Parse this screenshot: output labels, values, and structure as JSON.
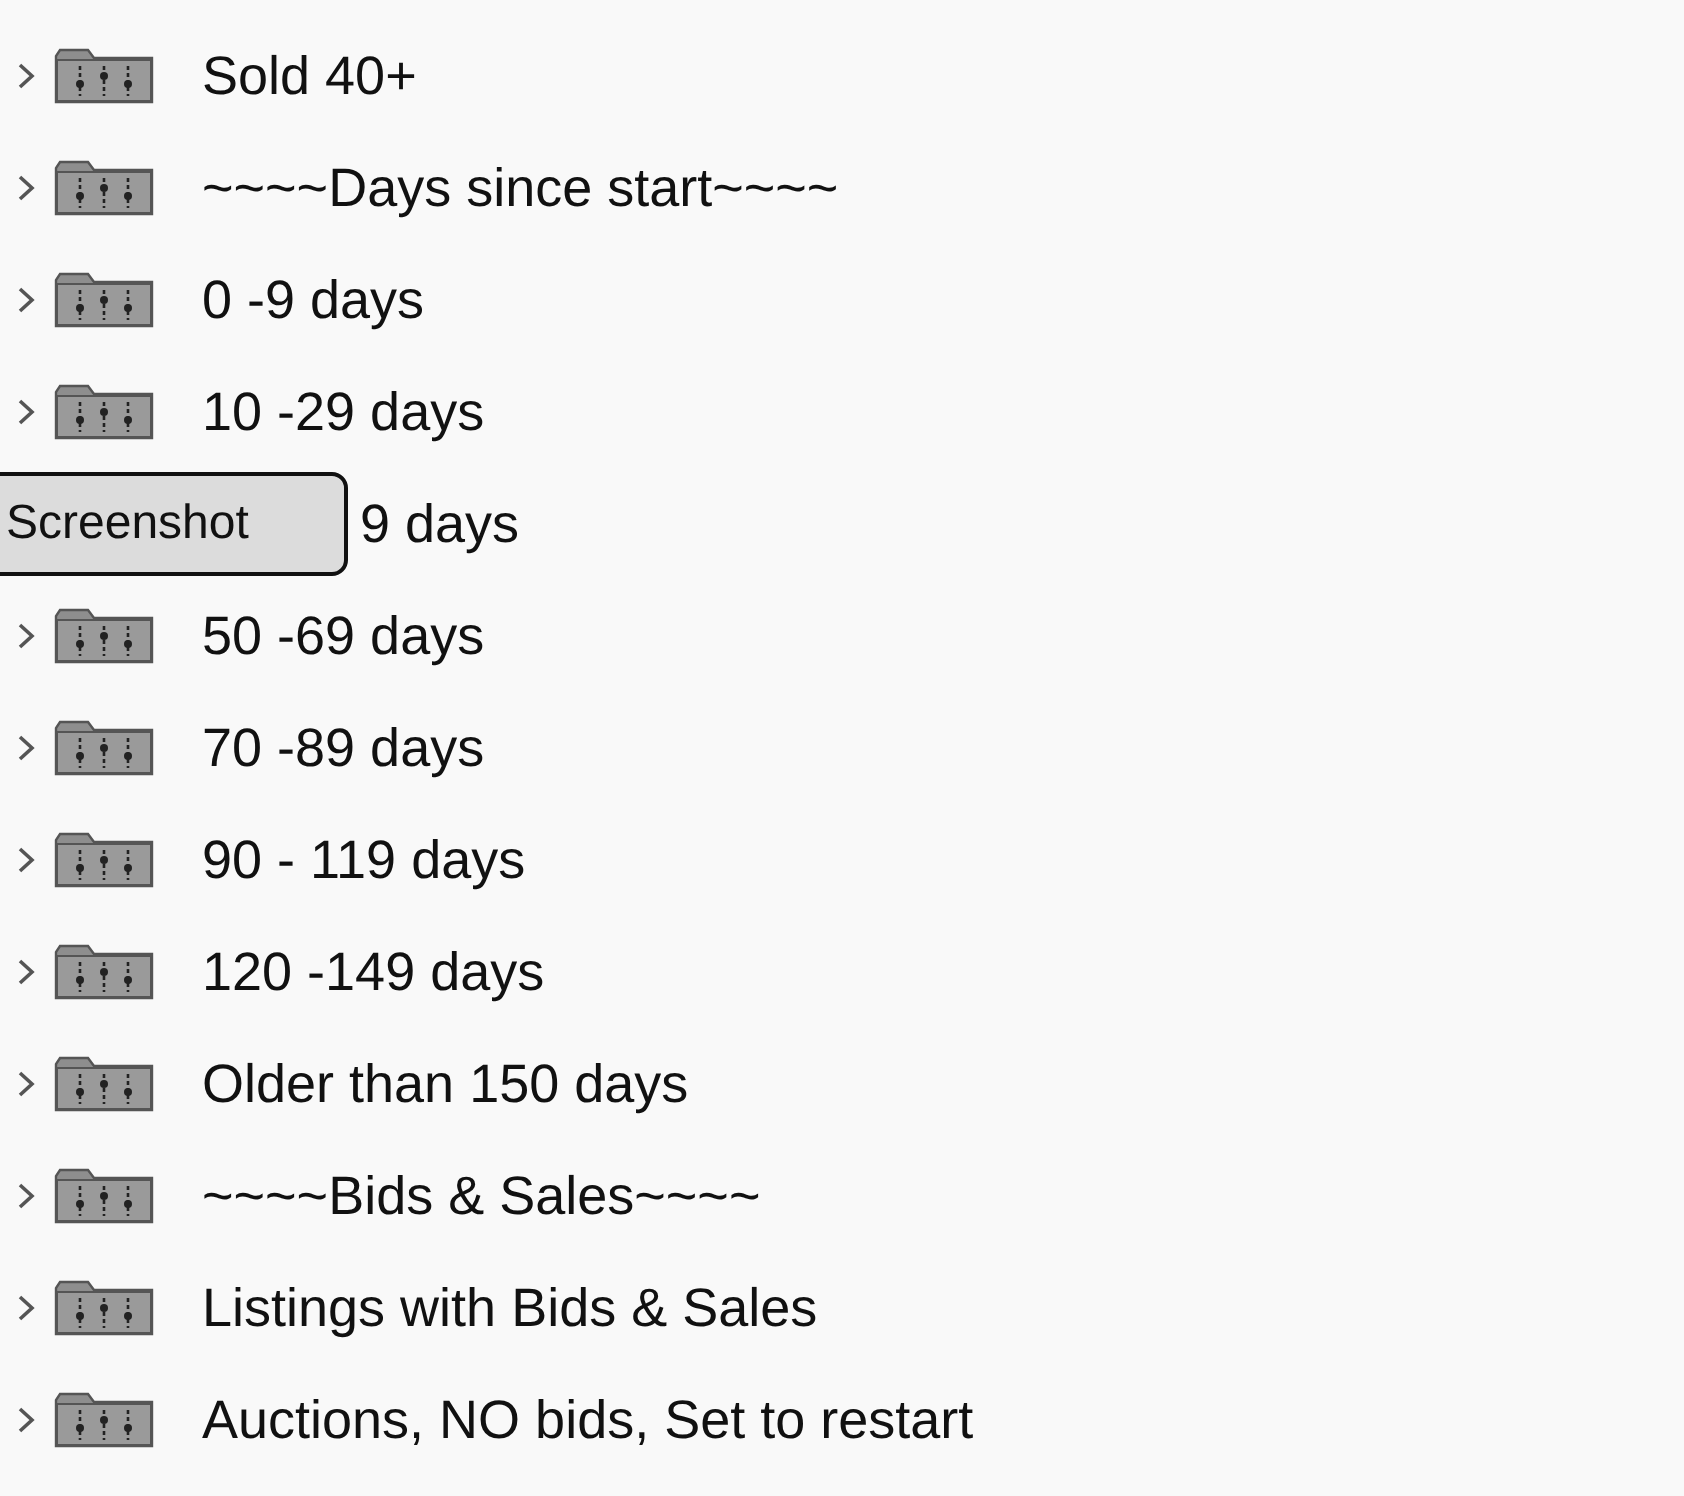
{
  "rows": [
    {
      "label": "Sold 40+",
      "covered": false
    },
    {
      "label": "~~~~Days since start~~~~",
      "covered": false
    },
    {
      "label": "0 -9 days",
      "covered": false
    },
    {
      "label": "10 -29 days",
      "covered": false
    },
    {
      "label": "9 days",
      "covered": true
    },
    {
      "label": "50 -69 days",
      "covered": false
    },
    {
      "label": "70 -89 days",
      "covered": false
    },
    {
      "label": "90 - 119 days",
      "covered": false
    },
    {
      "label": "120 -149 days",
      "covered": false
    },
    {
      "label": "Older than 150 days",
      "covered": false
    },
    {
      "label": "~~~~Bids & Sales~~~~",
      "covered": false
    },
    {
      "label": "Listings with Bids & Sales",
      "covered": false
    },
    {
      "label": "Auctions, NO bids, Set to restart",
      "covered": false
    }
  ],
  "tooltip": {
    "text": "Screenshot"
  }
}
